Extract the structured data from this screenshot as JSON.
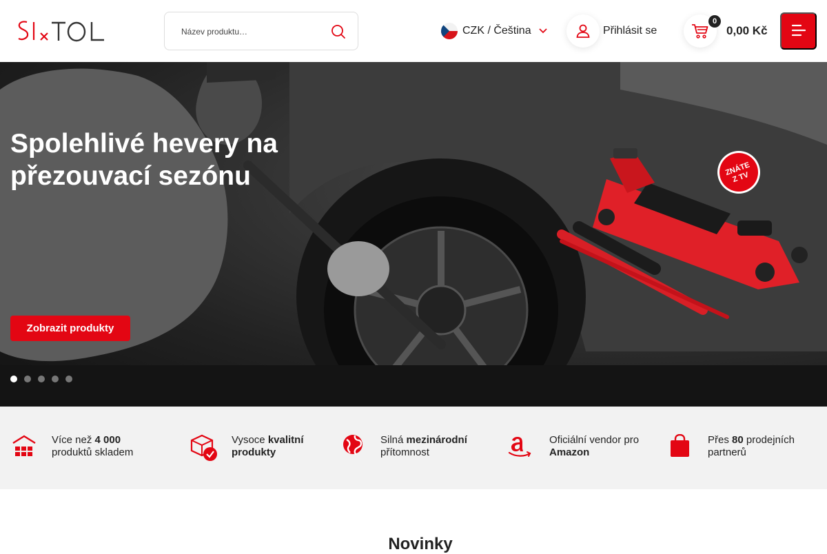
{
  "header": {
    "logo_text": "SIXTOL",
    "search": {
      "placeholder": "Název produktu…"
    },
    "language": {
      "label": "CZK / Čeština"
    },
    "login": {
      "label": "Přihlásit se"
    },
    "cart": {
      "count": "0",
      "total": "0,00 Kč"
    }
  },
  "hero": {
    "title": "Spolehlivé hevery na přezouvací sezónu",
    "cta": "Zobrazit produkty",
    "badge": "ZNÁTE Z TV",
    "slides": 5,
    "active_slide": 1
  },
  "features": [
    {
      "pre": "Více než ",
      "bold": "4 000",
      "post": " produktů skladem",
      "icon": "warehouse-icon"
    },
    {
      "pre": "Vysoce ",
      "bold": "kvalitní produkty",
      "post": "",
      "icon": "quality-box-icon"
    },
    {
      "pre": "Silná ",
      "bold": "mezinárodní",
      "post": " přítomnost",
      "icon": "globe-icon"
    },
    {
      "pre": "Oficiální vendor pro ",
      "bold": "Amazon",
      "post": "",
      "icon": "amazon-icon"
    },
    {
      "pre": "Přes ",
      "bold": "80",
      "post": " prodejních partnerů",
      "icon": "shopping-bag-icon"
    }
  ],
  "section": {
    "title": "Novinky"
  },
  "colors": {
    "accent": "#e30613",
    "dark": "#222222",
    "feature_bg": "#f2f2f2"
  }
}
